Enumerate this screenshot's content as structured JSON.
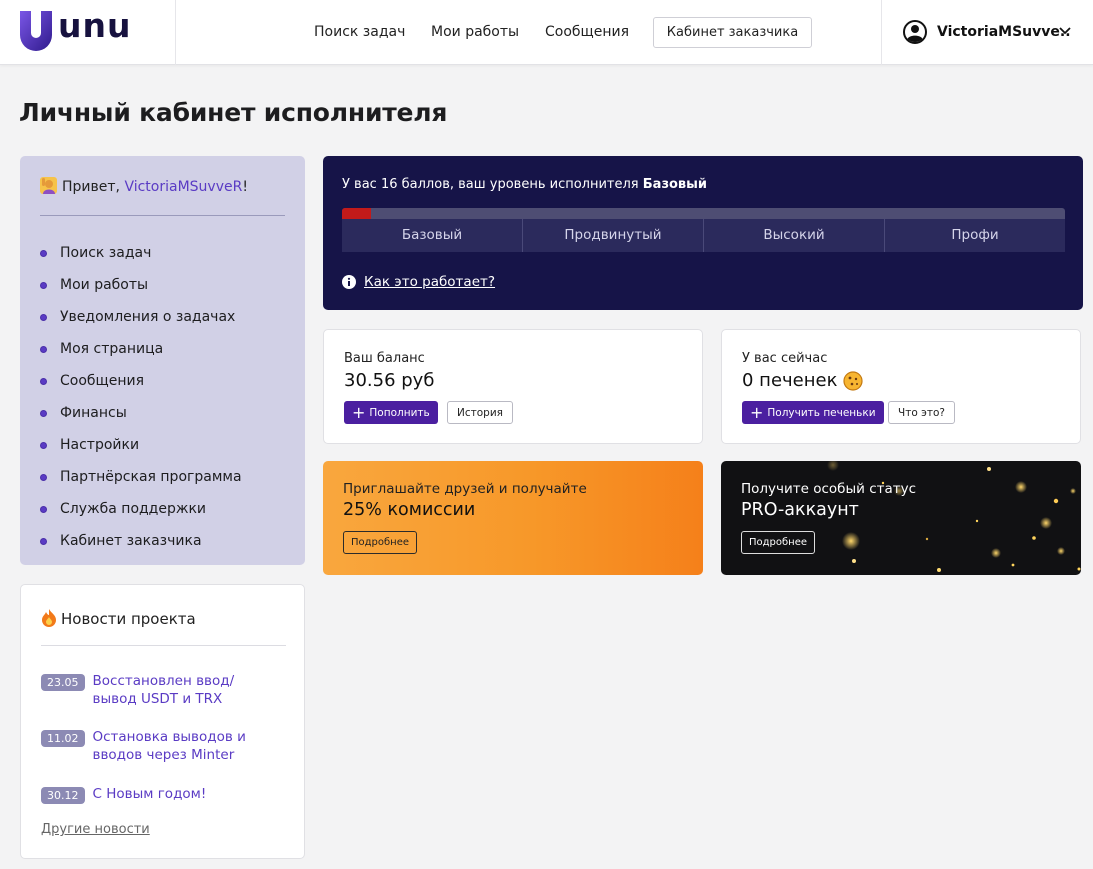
{
  "brand": {
    "name": "unu",
    "accent": "#4b1fa0",
    "logo_gradient": [
      "#6a46d8",
      "#3a1d9e"
    ]
  },
  "header": {
    "nav": [
      "Поиск задач",
      "Мои работы",
      "Сообщения"
    ],
    "customer_cabinet": "Кабинет заказчика",
    "user_name": "VictoriaMSuvve.."
  },
  "page": {
    "title": "Личный кабинет исполнителя"
  },
  "sidebar": {
    "greeting_prefix": "Привет, ",
    "greeting_user": "VictoriaMSuvveR",
    "greeting_suffix": "!",
    "items": [
      {
        "label": "Поиск задач"
      },
      {
        "label": "Мои работы"
      },
      {
        "label": "Уведомления о задачах"
      },
      {
        "label": "Моя страница"
      },
      {
        "label": "Сообщения"
      },
      {
        "label": "Финансы"
      },
      {
        "label": "Настройки"
      },
      {
        "label": "Партнёрская программа"
      },
      {
        "label": "Служба поддержки"
      },
      {
        "label": "Кабинет заказчика"
      }
    ]
  },
  "news": {
    "title": "Новости проекта",
    "items": [
      {
        "date": "23.05",
        "text": "Восстановлен ввод/вывод USDT и TRX"
      },
      {
        "date": "11.02",
        "text": "Остановка выводов и вводов через Minter"
      },
      {
        "date": "30.12",
        "text": "С Новым годом!"
      }
    ],
    "more": "Другие новости"
  },
  "level": {
    "text_prefix": "У вас 16 баллов, ваш уровень исполнителя ",
    "level_name": "Базовый",
    "progress_fraction": 0.04,
    "segments": [
      "Базовый",
      "Продвинутый",
      "Высокий",
      "Профи"
    ],
    "how_it_works": "Как это работает?"
  },
  "balance": {
    "label": "Ваш баланс",
    "value": "30.56 руб",
    "topup": "Пополнить",
    "history": "История"
  },
  "cookies": {
    "label": "У вас сейчас",
    "value": "0 печенек",
    "get": "Получить печеньки",
    "what": "Что это?"
  },
  "promo_referral": {
    "sub": "Приглашайте друзей и получайте",
    "main": "25% комиссии",
    "button": "Подробнее"
  },
  "promo_pro": {
    "sub": "Получите особый статус",
    "main": "PRO-аккаунт",
    "button": "Подробнее"
  }
}
